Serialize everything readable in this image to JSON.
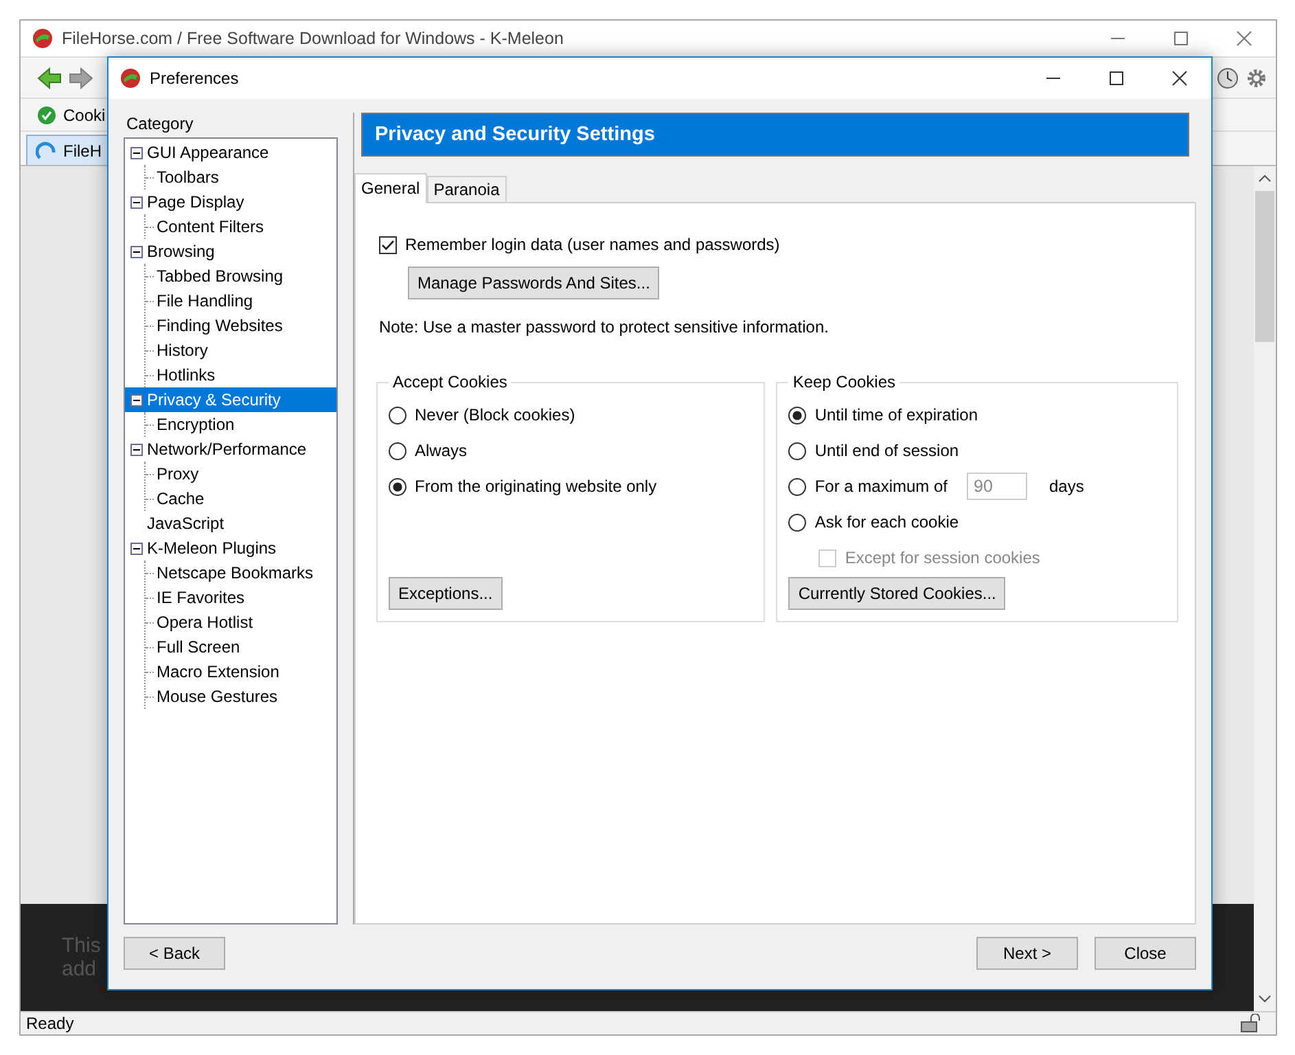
{
  "browser": {
    "title": "FileHorse.com / Free Software Download for Windows - K-Meleon",
    "bookmark": "Cooki",
    "tab": "FileH",
    "page_text": [
      "This",
      "add"
    ],
    "status": "Ready"
  },
  "dialog": {
    "title": "Preferences",
    "category_label": "Category",
    "tree": [
      {
        "label": "GUI Appearance",
        "expanded": true,
        "selected": false,
        "children": [
          {
            "label": "Toolbars",
            "selected": false
          }
        ]
      },
      {
        "label": "Page Display",
        "expanded": true,
        "selected": false,
        "children": [
          {
            "label": "Content Filters",
            "selected": false
          }
        ]
      },
      {
        "label": "Browsing",
        "expanded": true,
        "selected": false,
        "children": [
          {
            "label": "Tabbed Browsing",
            "selected": false
          },
          {
            "label": "File Handling",
            "selected": false
          },
          {
            "label": "Finding Websites",
            "selected": false
          },
          {
            "label": "History",
            "selected": false
          },
          {
            "label": "Hotlinks",
            "selected": false
          }
        ]
      },
      {
        "label": "Privacy & Security",
        "expanded": true,
        "selected": true,
        "children": [
          {
            "label": "Encryption",
            "selected": false
          }
        ]
      },
      {
        "label": "Network/Performance",
        "expanded": true,
        "selected": false,
        "children": [
          {
            "label": "Proxy",
            "selected": false
          },
          {
            "label": "Cache",
            "selected": false
          }
        ]
      },
      {
        "label": "JavaScript",
        "selected": false
      },
      {
        "label": "K-Meleon Plugins",
        "expanded": true,
        "selected": false,
        "children": [
          {
            "label": "Netscape Bookmarks",
            "selected": false
          },
          {
            "label": "IE Favorites",
            "selected": false
          },
          {
            "label": "Opera Hotlist",
            "selected": false
          },
          {
            "label": "Full Screen",
            "selected": false
          },
          {
            "label": "Macro Extension",
            "selected": false
          },
          {
            "label": "Mouse Gestures",
            "selected": false
          }
        ]
      }
    ],
    "header": "Privacy and Security Settings",
    "tabs": [
      {
        "label": "General",
        "selected": true
      },
      {
        "label": "Paranoia",
        "selected": false
      }
    ],
    "remember_login": {
      "label": "Remember login data (user names and passwords)",
      "checked": true
    },
    "manage_button": "Manage Passwords And Sites...",
    "note": "Note: Use a master password to protect sensitive information.",
    "accept_cookies": {
      "title": "Accept Cookies",
      "options": [
        {
          "label": "Never (Block cookies)",
          "selected": false
        },
        {
          "label": "Always",
          "selected": false
        },
        {
          "label": "From the originating website only",
          "selected": true
        }
      ],
      "button": "Exceptions..."
    },
    "keep_cookies": {
      "title": "Keep Cookies",
      "options": [
        {
          "kind": "plain",
          "label": "Until time of expiration",
          "selected": true
        },
        {
          "kind": "plain",
          "label": "Until end of session",
          "selected": false
        },
        {
          "kind": "days",
          "label": "For a maximum of",
          "value": "90",
          "suffix": "days",
          "selected": false
        },
        {
          "kind": "plain",
          "label": "Ask for each cookie",
          "selected": false
        }
      ],
      "except": {
        "label": "Except for session cookies",
        "checked": false,
        "disabled": true
      },
      "button": "Currently Stored Cookies..."
    },
    "buttons_left": [
      "< Back"
    ],
    "buttons_right": [
      "Next >",
      "Close"
    ]
  }
}
